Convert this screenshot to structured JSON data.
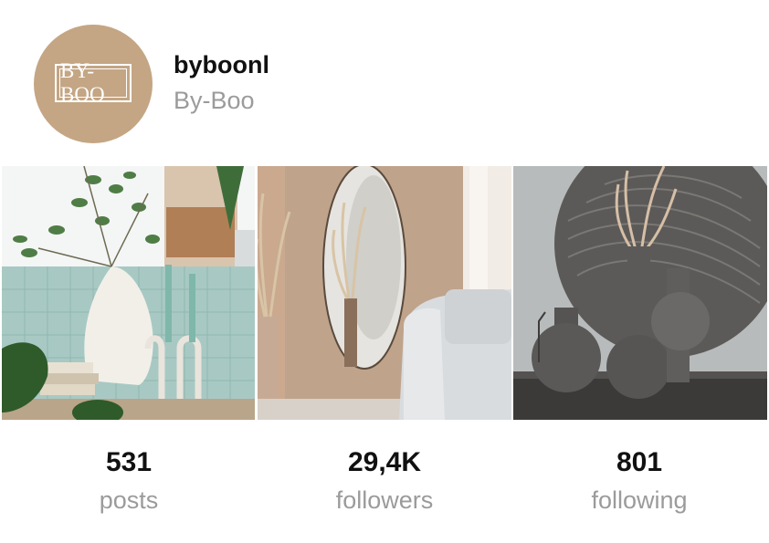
{
  "profile": {
    "avatar_text": "BY-BOO",
    "username": "byboonl",
    "display_name": "By-Boo"
  },
  "posts": [
    {
      "name": "post-1"
    },
    {
      "name": "post-2"
    },
    {
      "name": "post-3"
    }
  ],
  "stats": {
    "posts": {
      "value": "531",
      "label": "posts"
    },
    "followers": {
      "value": "29,4K",
      "label": "followers"
    },
    "following": {
      "value": "801",
      "label": "following"
    }
  }
}
